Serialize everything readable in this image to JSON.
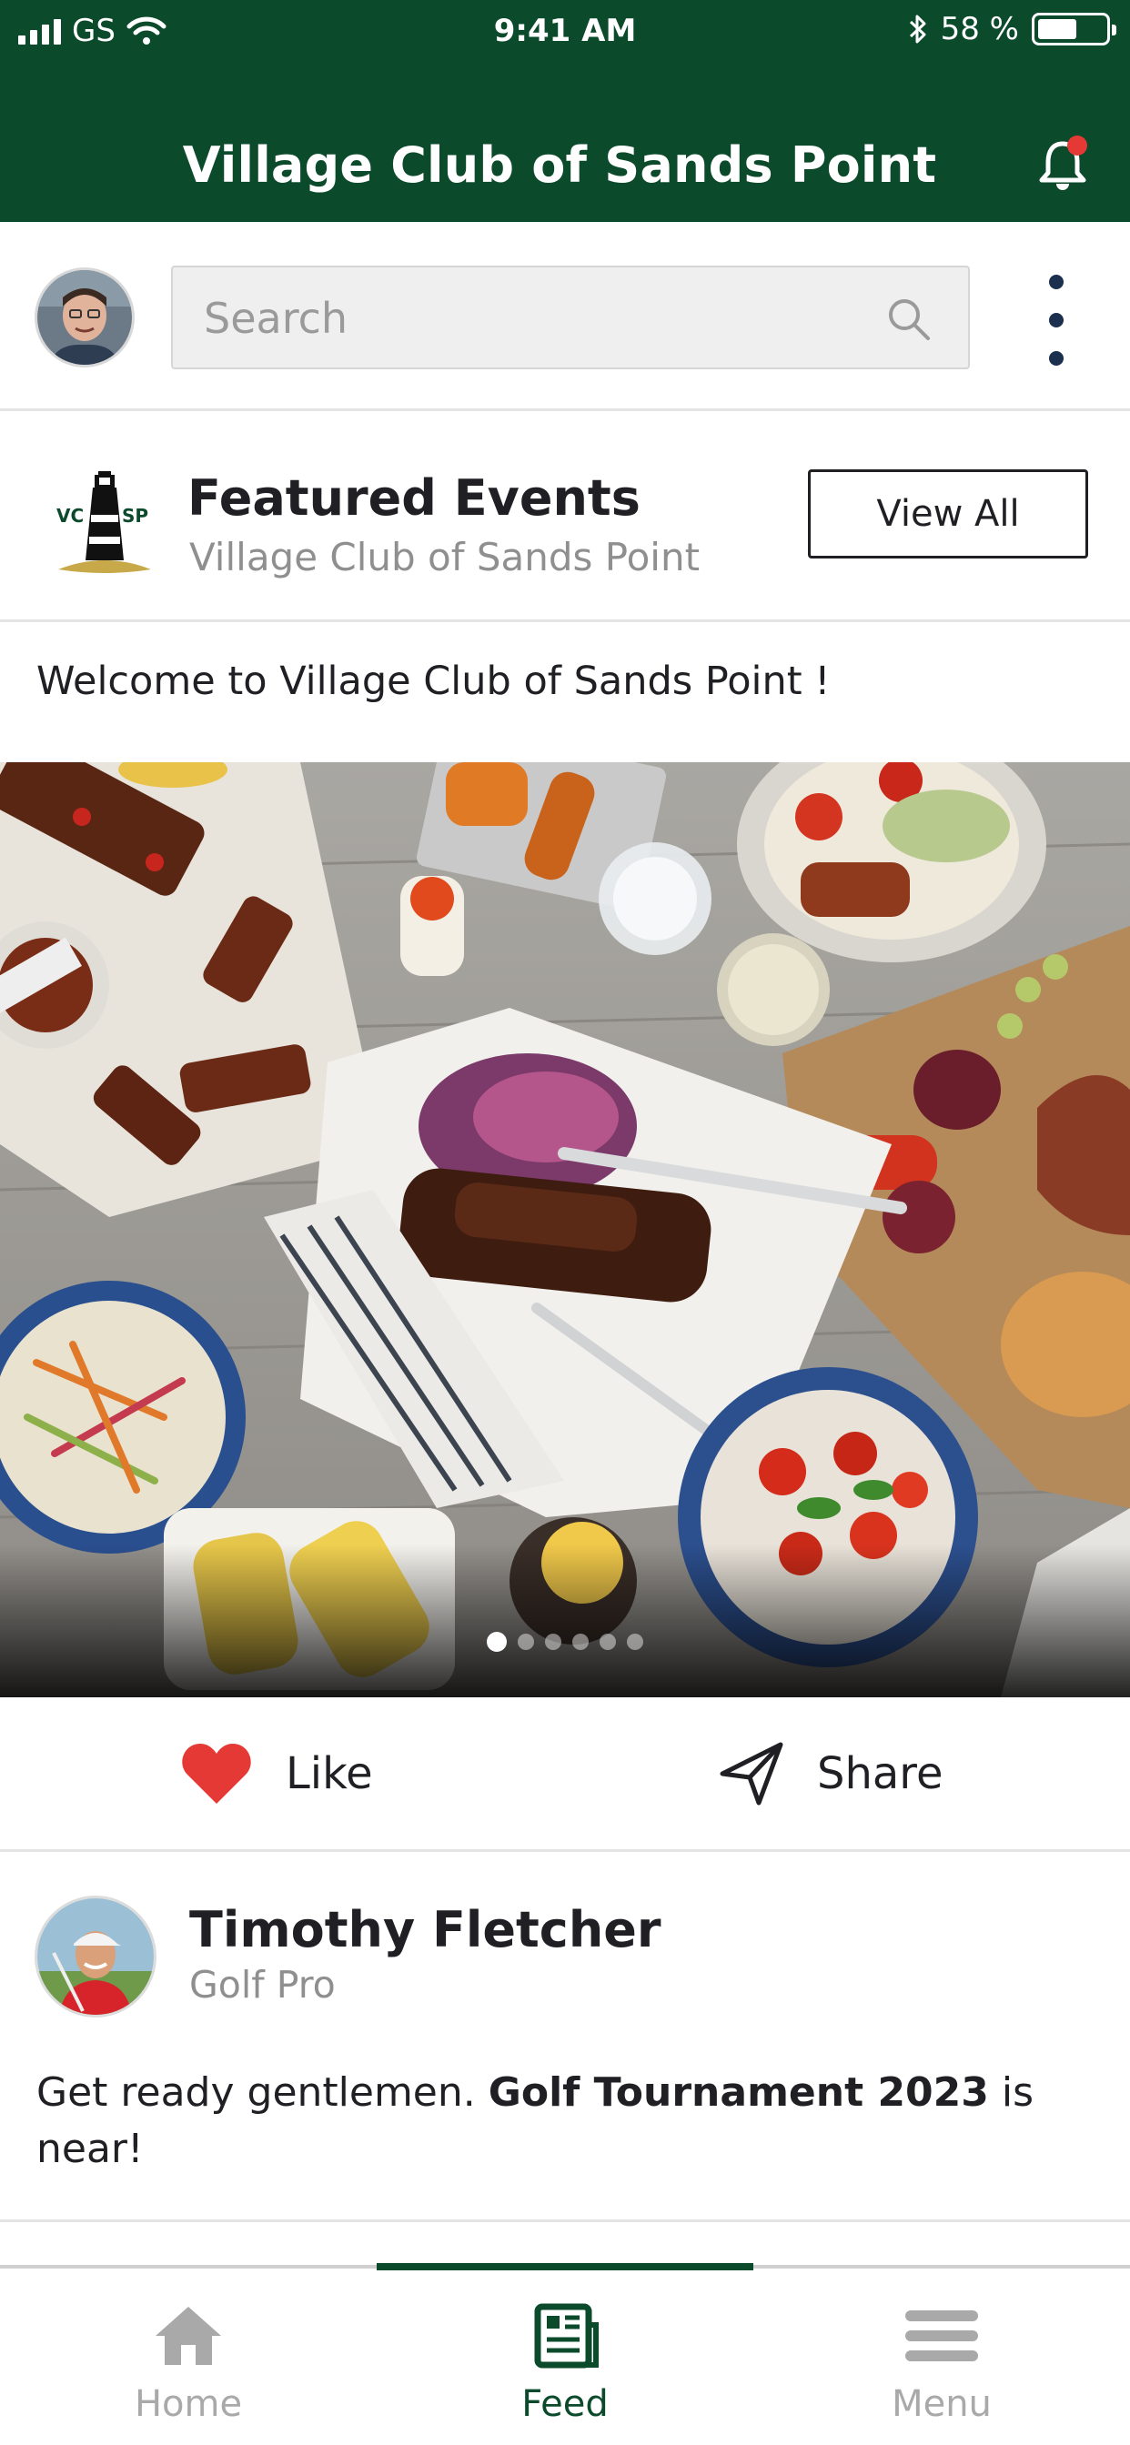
{
  "status_bar": {
    "carrier": "GS",
    "time": "9:41 AM",
    "battery_percent": "58 %",
    "battery_level": 0.58
  },
  "header": {
    "title": "Village Club of Sands Point",
    "notification_dot_color": "#e53935"
  },
  "search": {
    "placeholder": "Search"
  },
  "featured": {
    "title": "Featured Events",
    "subtitle": "Village Club of Sands Point",
    "view_all_label": "View All",
    "logo_text_left": "VC",
    "logo_text_right": "SP"
  },
  "welcome_text": "Welcome to Village Club of Sands Point !",
  "carousel": {
    "slide_count": 6,
    "active_index": 0
  },
  "actions": {
    "like_label": "Like",
    "share_label": "Share",
    "like_color": "#e53935"
  },
  "post": {
    "author": "Timothy Fletcher",
    "role": "Golf Pro",
    "text_before": "Get ready gentlemen. ",
    "text_bold": "Golf Tournament 2023",
    "text_after": " is near!"
  },
  "tabs": [
    {
      "label": "Home",
      "icon": "home-icon",
      "active": false
    },
    {
      "label": "Feed",
      "icon": "feed-icon",
      "active": true
    },
    {
      "label": "Menu",
      "icon": "menu-icon",
      "active": false
    }
  ],
  "colors": {
    "brand_green": "#0c4a2c",
    "inactive_gray": "#a9a9a9"
  }
}
